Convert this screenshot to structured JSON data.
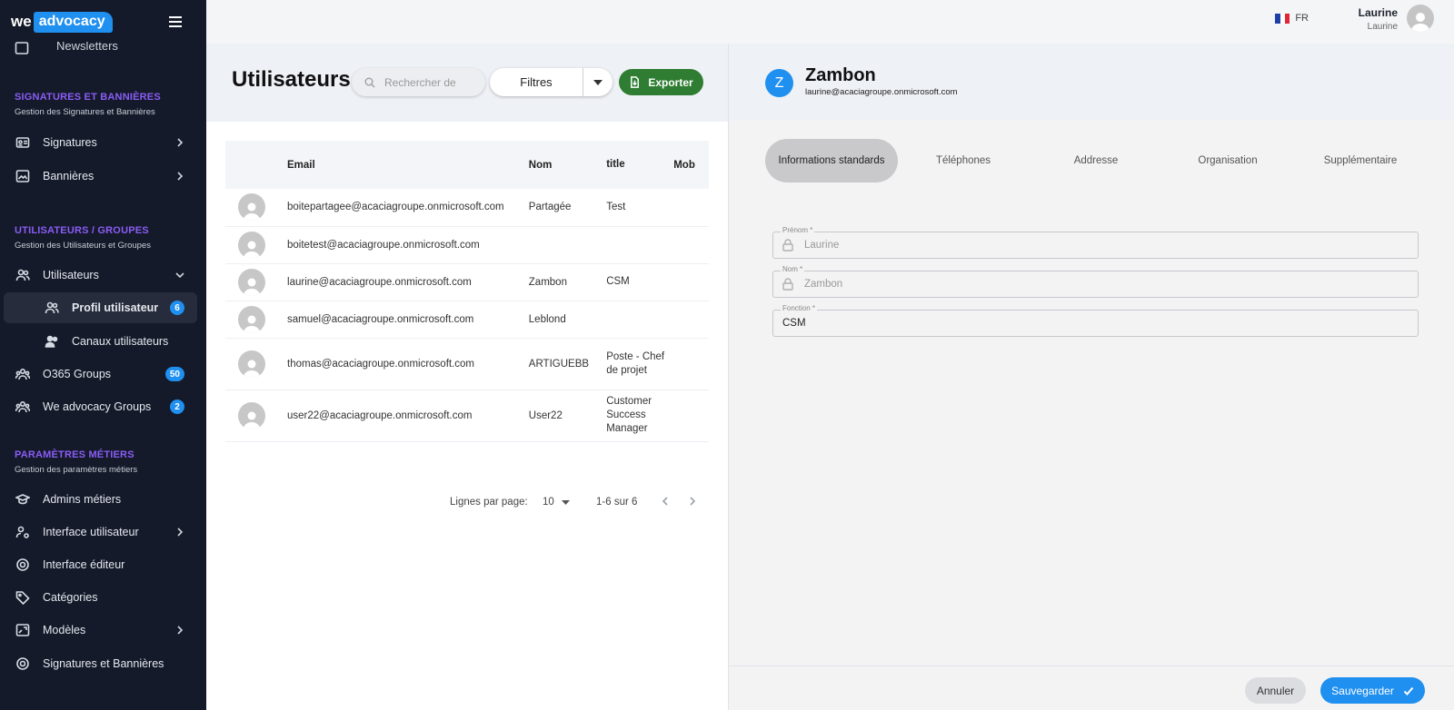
{
  "brand": {
    "we": "we",
    "advocacy": "advocacy"
  },
  "sidebar": {
    "partial_item": "Newsletters",
    "sections": [
      {
        "title": "SIGNATURES ET BANNIÈRES",
        "subtitle": "Gestion des Signatures et Bannières"
      },
      {
        "title": "UTILISATEURS / GROUPES",
        "subtitle": "Gestion des Utilisateurs et Groupes"
      },
      {
        "title": "PARAMÈTRES MÉTIERS",
        "subtitle": "Gestion des paramètres métiers"
      }
    ],
    "items": {
      "signatures": "Signatures",
      "bannieres": "Bannières",
      "utilisateurs": "Utilisateurs",
      "profil_utilisateur": "Profil utilisateur",
      "profil_badge": "6",
      "canaux_utilisateurs": "Canaux utilisateurs",
      "o365_groups": "O365 Groups",
      "o365_badge": "50",
      "weadvocacy_groups": "We advocacy Groups",
      "weadvocacy_badge": "2",
      "admins_metiers": "Admins métiers",
      "interface_utilisateur": "Interface utilisateur",
      "interface_editeur": "Interface éditeur",
      "categories": "Catégories",
      "modeles": "Modèles",
      "signatures_bannieres": "Signatures et Bannières"
    }
  },
  "topbar": {
    "lang": "FR",
    "user_name": "Laurine",
    "user_sub": "Laurine"
  },
  "users": {
    "title": "Utilisateurs",
    "search_placeholder": "Rechercher de",
    "filter_label": "Filtres",
    "export_label": "Exporter",
    "columns": {
      "email": "Email",
      "nom": "Nom",
      "title": "title",
      "mobile": "Mob"
    },
    "rows": [
      {
        "email": "boitepartagee@acaciagroupe.onmicrosoft.com",
        "nom": "Partagée",
        "title": "Test"
      },
      {
        "email": "boitetest@acaciagroupe.onmicrosoft.com",
        "nom": "",
        "title": ""
      },
      {
        "email": "laurine@acaciagroupe.onmicrosoft.com",
        "nom": "Zambon",
        "title": "CSM"
      },
      {
        "email": "samuel@acaciagroupe.onmicrosoft.com",
        "nom": "Leblond",
        "title": ""
      },
      {
        "email": "thomas@acaciagroupe.onmicrosoft.com",
        "nom": "ARTIGUEBB",
        "title": "Poste - Chef de projet"
      },
      {
        "email": "user22@acaciagroupe.onmicrosoft.com",
        "nom": "User22",
        "title": "Customer Success Manager"
      }
    ],
    "pagination": {
      "rows_label": "Lignes par page:",
      "rows_value": "10",
      "range": "1-6 sur 6"
    }
  },
  "detail": {
    "avatar_letter": "Z",
    "name": "Zambon",
    "email": "laurine@acaciagroupe.onmicrosoft.com",
    "tabs": [
      "Informations standards",
      "Téléphones",
      "Addresse",
      "Organisation",
      "Supplémentaire"
    ],
    "fields": {
      "prenom_label": "Prénom *",
      "prenom_value": "Laurine",
      "nom_label": "Nom *",
      "nom_value": "Zambon",
      "fonction_label": "Fonction *",
      "fonction_value": "CSM"
    },
    "cancel_label": "Annuler",
    "save_label": "Sauvegarder"
  },
  "colors": {
    "accent": "#1f8ff0",
    "sidebar_bg": "#141a2a",
    "section_title": "#8b5cf6",
    "export": "#2e7d32"
  }
}
